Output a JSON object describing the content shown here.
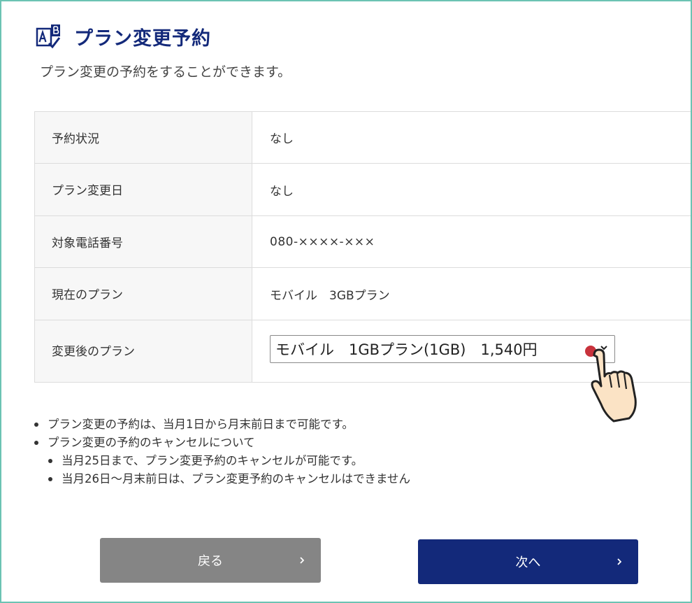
{
  "page": {
    "title": "プラン変更予約",
    "subtitle": "プラン変更の予約をすることができます。"
  },
  "table": {
    "rows": [
      {
        "label": "予約状況",
        "value": "なし"
      },
      {
        "label": "プラン変更日",
        "value": "なし"
      },
      {
        "label": "対象電話番号",
        "value": "080-××××-×××"
      },
      {
        "label": "現在のプラン",
        "value": "モバイル　3GBプラン"
      },
      {
        "label": "変更後のプラン",
        "value": "モバイル　1GBプラン(1GB)　1,540円"
      }
    ]
  },
  "notes": [
    {
      "text": "プラン変更の予約は、当月1日から月末前日まで可能です。",
      "level": 1
    },
    {
      "text": "プラン変更の予約のキャンセルについて",
      "level": 1
    },
    {
      "text": "当月25日まで、プラン変更予約のキャンセルが可能です。",
      "level": 2
    },
    {
      "text": "当月26日～月末前日は、プラン変更予約のキャンセルはできません",
      "level": 2
    }
  ],
  "buttons": {
    "back": "戻る",
    "next": "次へ"
  },
  "icons": {
    "title_icon": "plan-change-ab-icon",
    "select_chevron": "chevron-down-icon",
    "pointer": "pointing-hand-icon",
    "button_arrow": "chevron-right-icon"
  },
  "colors": {
    "accent_navy": "#13297a",
    "back_button": "#858585",
    "frame_border": "#6cc3b3",
    "label_bg": "#f7f7f7",
    "click_marker": "#c8323c"
  }
}
